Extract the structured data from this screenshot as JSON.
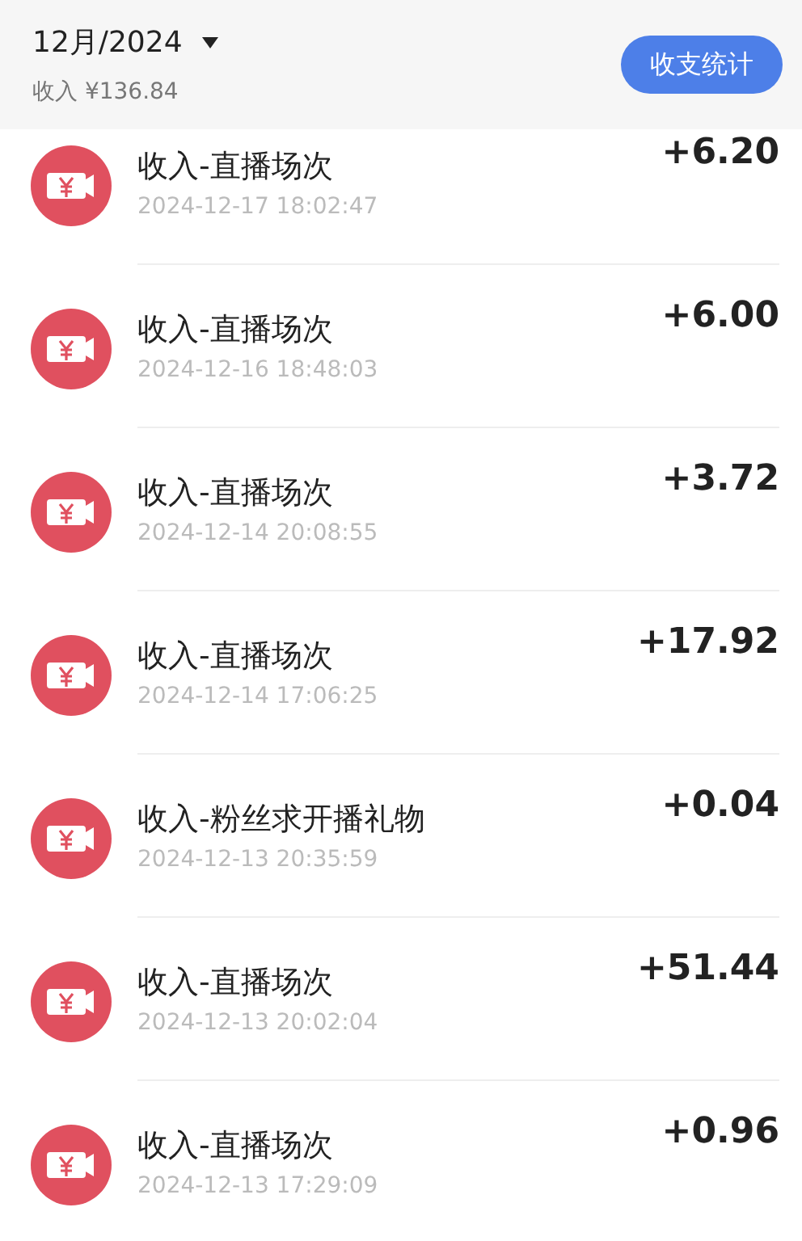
{
  "header": {
    "month": "12月/2024",
    "income": "收入 ¥136.84",
    "stats_button": "收支统计"
  },
  "transactions": [
    {
      "title": "收入-直播场次",
      "time": "2024-12-17 18:02:47",
      "amount": "+6.20"
    },
    {
      "title": "收入-直播场次",
      "time": "2024-12-16 18:48:03",
      "amount": "+6.00"
    },
    {
      "title": "收入-直播场次",
      "time": "2024-12-14 20:08:55",
      "amount": "+3.72"
    },
    {
      "title": "收入-直播场次",
      "time": "2024-12-14 17:06:25",
      "amount": "+17.92"
    },
    {
      "title": "收入-粉丝求开播礼物",
      "time": "2024-12-13 20:35:59",
      "amount": "+0.04"
    },
    {
      "title": "收入-直播场次",
      "time": "2024-12-13 20:02:04",
      "amount": "+51.44"
    },
    {
      "title": "收入-直播场次",
      "time": "2024-12-13 17:29:09",
      "amount": "+0.96"
    }
  ]
}
